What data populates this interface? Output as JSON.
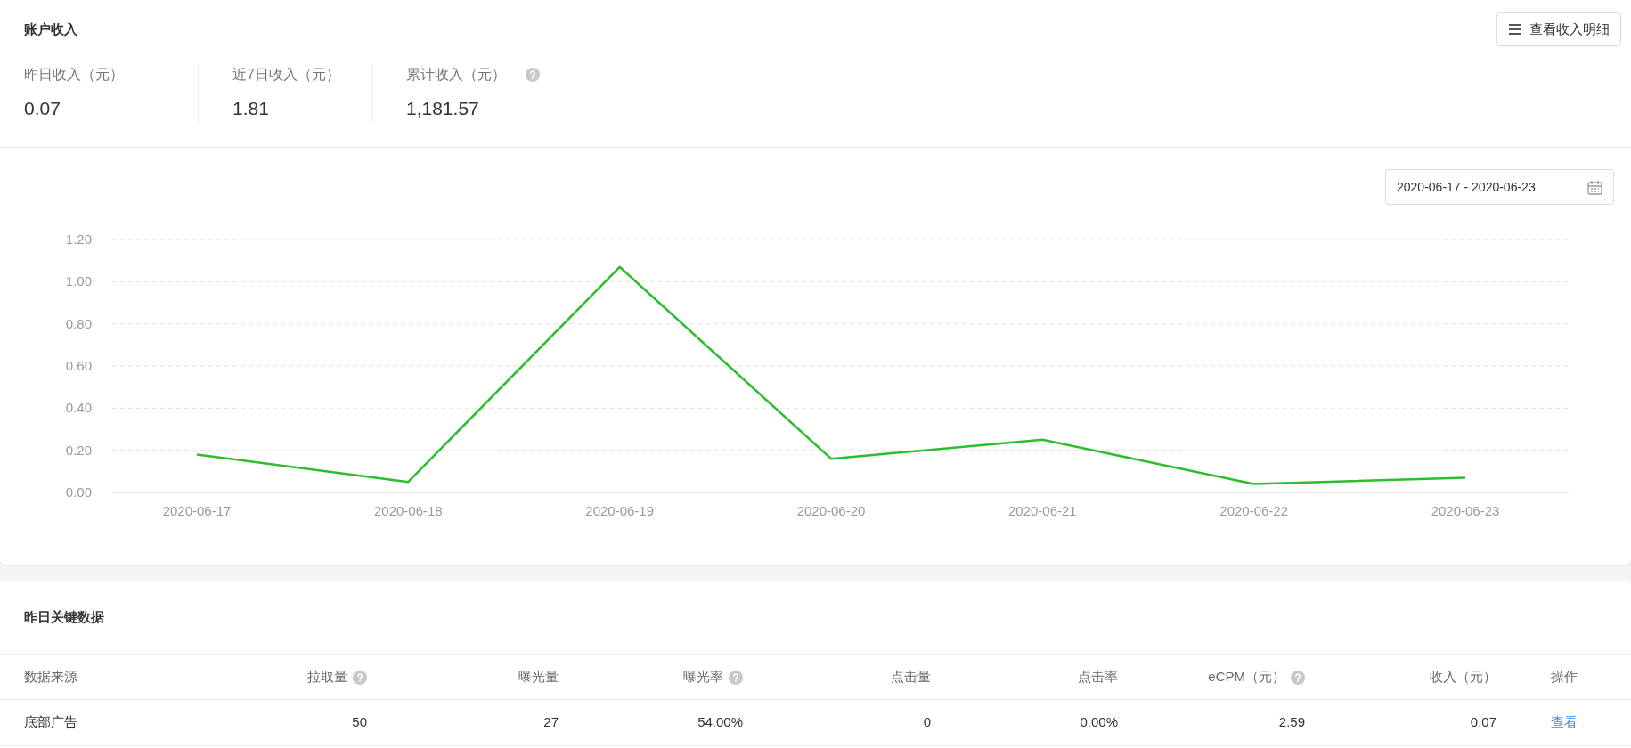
{
  "account": {
    "title": "账户收入",
    "detail_button": "查看收入明细",
    "stats": [
      {
        "label": "昨日收入（元）",
        "value": "0.07",
        "help": false
      },
      {
        "label": "近7日收入（元）",
        "value": "1.81",
        "help": false
      },
      {
        "label": "累计收入（元）",
        "value": "1,181.57",
        "help": true
      }
    ]
  },
  "chart": {
    "date_range": "2020-06-17 - 2020-06-23",
    "chart_data": {
      "type": "line",
      "categories": [
        "2020-06-17",
        "2020-06-18",
        "2020-06-19",
        "2020-06-20",
        "2020-06-21",
        "2020-06-22",
        "2020-06-23"
      ],
      "series": [
        {
          "color": "#2ebd2e",
          "values": [
            0.18,
            0.05,
            1.07,
            0.16,
            0.25,
            0.04,
            0.07
          ]
        }
      ],
      "grid": true,
      "ylim": [
        0,
        1.2
      ],
      "yticks": [
        {
          "value": 0,
          "label": "0.00"
        },
        {
          "value": 0.2,
          "label": "0.20"
        },
        {
          "value": 0.4,
          "label": "0.40"
        },
        {
          "value": 0.6,
          "label": "0.60"
        },
        {
          "value": 0.8,
          "label": "0.80"
        },
        {
          "value": 1,
          "label": "1.00"
        },
        {
          "value": 1.2,
          "label": "1.20"
        }
      ]
    }
  },
  "key_data": {
    "title": "昨日关键数据",
    "table": {
      "columns": [
        {
          "label": "数据来源",
          "help": false
        },
        {
          "label": "拉取量",
          "help": true
        },
        {
          "label": "曝光量",
          "help": false
        },
        {
          "label": "曝光率",
          "help": true
        },
        {
          "label": "点击量",
          "help": false
        },
        {
          "label": "点击率",
          "help": false
        },
        {
          "label": "eCPM（元）",
          "help": true
        },
        {
          "label": "收入（元）",
          "help": false
        },
        {
          "label": "操作",
          "help": false
        }
      ],
      "rows": [
        {
          "cells": [
            "底部广告",
            "50",
            "27",
            "54.00%",
            "0",
            "0.00%",
            "2.59",
            "0.07"
          ],
          "action": "查看"
        }
      ]
    }
  }
}
